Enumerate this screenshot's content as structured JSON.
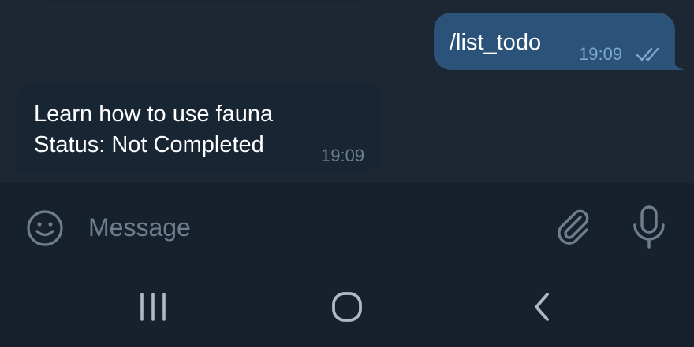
{
  "chat": {
    "outgoing": {
      "text": "/list_todo",
      "time": "19:09",
      "status_icon": "double-check-icon"
    },
    "incoming": {
      "line1": "Learn how to use fauna",
      "line2": "Status: Not Completed",
      "time": "19:09"
    }
  },
  "composer": {
    "placeholder": "Message",
    "icons": [
      "emoji-icon",
      "attach-icon",
      "mic-icon"
    ]
  },
  "system_nav": {
    "icons": [
      "recents-icon",
      "home-icon",
      "back-icon"
    ]
  },
  "colors": {
    "chat_background": "#1d2733",
    "panel_background": "#17212b",
    "outgoing_bubble": "#2b5278",
    "incoming_bubble": "#182533",
    "outgoing_meta": "#7da8d3",
    "incoming_meta": "#6d7f8f",
    "icon_gray": "#6d7f8f"
  }
}
